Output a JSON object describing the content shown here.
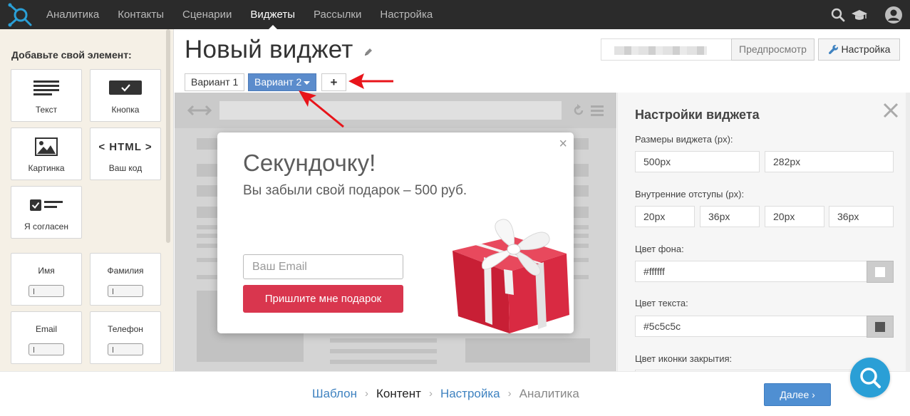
{
  "nav": {
    "items": [
      {
        "label": "Аналитика"
      },
      {
        "label": "Контакты"
      },
      {
        "label": "Сценарии"
      },
      {
        "label": "Виджеты"
      },
      {
        "label": "Рассылки"
      },
      {
        "label": "Настройка"
      }
    ],
    "active_index": 3
  },
  "palette": {
    "heading": "Добавьте свой элемент:",
    "tiles": {
      "text": "Текст",
      "button": "Кнопка",
      "image": "Картинка",
      "html_title": "< HTML >",
      "html": "Ваш код",
      "agree": "Я согласен",
      "first_name": "Имя",
      "last_name": "Фамилия",
      "email": "Email",
      "phone": "Телефон"
    }
  },
  "editor": {
    "title": "Новый виджет",
    "tabs": [
      "Вариант 1",
      "Вариант 2",
      "+"
    ],
    "preview_label": "Предпросмотр",
    "settings_label": "Настройка"
  },
  "popup": {
    "heading": "Секундочку!",
    "subheading": "Вы забыли свой подарок – 500 руб.",
    "email_placeholder": "Ваш Email",
    "submit_label": "Пришлите мне подарок",
    "close": "×"
  },
  "settings": {
    "title": "Настройки виджета",
    "size_label": "Размеры виджета (px):",
    "width": "500px",
    "height": "282px",
    "padding_label": "Внутренние отступы (px):",
    "padding": [
      "20px",
      "36px",
      "20px",
      "36px"
    ],
    "bg_label": "Цвет фона:",
    "bg_value": "#ffffff",
    "text_label": "Цвет текста:",
    "text_value": "#5c5c5c",
    "close_label": "Цвет иконки закрытия:"
  },
  "footer": {
    "steps": [
      {
        "label": "Шаблон"
      },
      {
        "label": "Контент"
      },
      {
        "label": "Настройка"
      },
      {
        "label": "Аналитика"
      }
    ],
    "next_label": "Далее ›"
  },
  "colors": {
    "accent": "#4f8fd2",
    "submit": "#d9364e",
    "arrow": "#e8141a"
  }
}
